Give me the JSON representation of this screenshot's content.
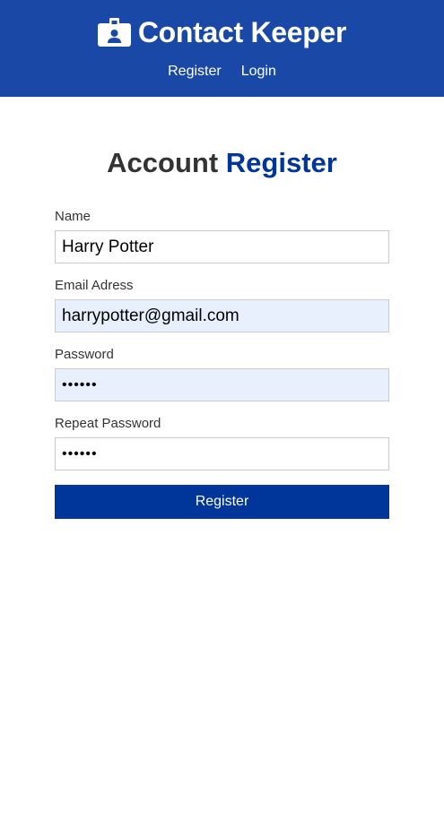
{
  "navbar": {
    "icon": "id-badge-icon",
    "title": "Contact Keeper",
    "links": [
      {
        "label": "Register"
      },
      {
        "label": "Login"
      }
    ]
  },
  "page": {
    "heading_prefix": "Account",
    "heading_accent": "Register"
  },
  "form": {
    "fields": [
      {
        "label": "Name",
        "value": "Harry Potter",
        "type": "text"
      },
      {
        "label": "Email Adress",
        "value": "harrypotter@gmail.com",
        "type": "email"
      },
      {
        "label": "Password",
        "value": "••••••",
        "type": "password"
      },
      {
        "label": "Repeat Password",
        "value": "••••••",
        "type": "password"
      }
    ],
    "submit_label": "Register"
  },
  "colors": {
    "navbar": "#1a48a6",
    "accent": "#003699",
    "autofill": "#e8f0fe"
  }
}
